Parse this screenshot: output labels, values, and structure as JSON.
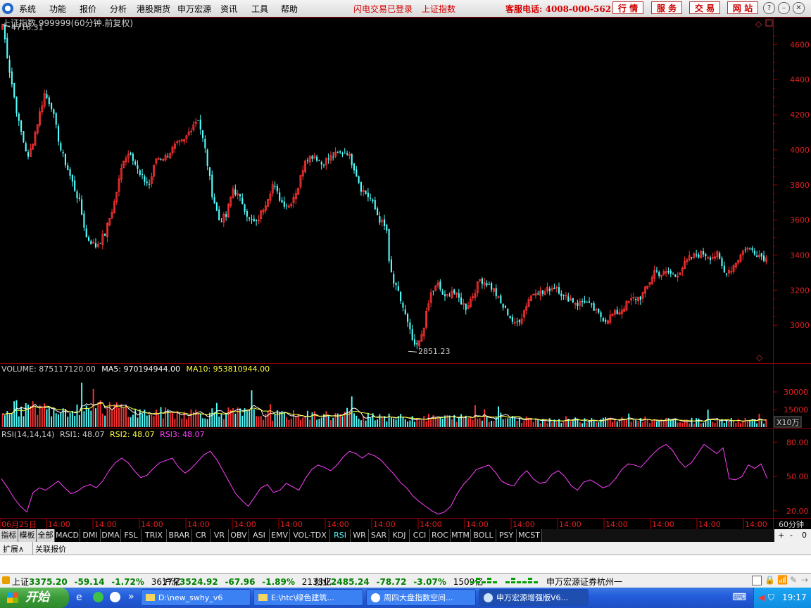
{
  "menu": {
    "items": [
      "系统",
      "功能",
      "报价",
      "分析",
      "港股期货",
      "申万宏源",
      "资讯",
      "工具",
      "帮助"
    ],
    "status1": "闪电交易已登录",
    "status2": "上证指数",
    "hotline": "客服电话: 4008-000-562",
    "nav_buttons": [
      "行 情",
      "服 务",
      "交 易",
      "网 站"
    ]
  },
  "chart_data": [
    {
      "type": "candlestick",
      "title": "上证指数 999999(60分钟.前复权)",
      "ylim": [
        2800,
        4750
      ],
      "yticks": [
        3000,
        3200,
        3400,
        3600,
        3800,
        4000,
        4200,
        4400,
        4600
      ],
      "annotations": [
        {
          "text": "4716.31",
          "value": 4716.31
        },
        {
          "text": "2851.23",
          "value": 2851.23
        }
      ],
      "colors": {
        "up": "#ff3232",
        "down": "#54ffff"
      },
      "close_path": [
        [
          0,
          4716
        ],
        [
          3,
          4450
        ],
        [
          7,
          4150
        ],
        [
          11,
          3950
        ],
        [
          14,
          4100
        ],
        [
          18,
          4320
        ],
        [
          21,
          4250
        ],
        [
          25,
          4000
        ],
        [
          29,
          3850
        ],
        [
          33,
          3700
        ],
        [
          36,
          3500
        ],
        [
          40,
          3450
        ],
        [
          44,
          3520
        ],
        [
          48,
          3700
        ],
        [
          52,
          3950
        ],
        [
          55,
          3990
        ],
        [
          59,
          3850
        ],
        [
          63,
          3800
        ],
        [
          66,
          3950
        ],
        [
          70,
          3960
        ],
        [
          74,
          4020
        ],
        [
          78,
          4050
        ],
        [
          82,
          4150
        ],
        [
          84,
          4180
        ],
        [
          87,
          4000
        ],
        [
          90,
          3750
        ],
        [
          93,
          3600
        ],
        [
          96,
          3620
        ],
        [
          99,
          3780
        ],
        [
          103,
          3700
        ],
        [
          106,
          3600
        ],
        [
          109,
          3580
        ],
        [
          113,
          3700
        ],
        [
          116,
          3800
        ],
        [
          120,
          3700
        ],
        [
          123,
          3680
        ],
        [
          127,
          3790
        ],
        [
          130,
          3950
        ],
        [
          134,
          3970
        ],
        [
          137,
          3920
        ],
        [
          141,
          3960
        ],
        [
          145,
          3980
        ],
        [
          148,
          3990
        ],
        [
          151,
          3900
        ],
        [
          154,
          3780
        ],
        [
          158,
          3720
        ],
        [
          162,
          3600
        ],
        [
          165,
          3540
        ],
        [
          166,
          3350
        ],
        [
          168,
          3240
        ],
        [
          170,
          3180
        ],
        [
          172,
          3100
        ],
        [
          175,
          2960
        ],
        [
          177,
          2870
        ],
        [
          179,
          2900
        ],
        [
          181,
          3000
        ],
        [
          184,
          3180
        ],
        [
          187,
          3230
        ],
        [
          190,
          3150
        ],
        [
          193,
          3200
        ],
        [
          196,
          3150
        ],
        [
          199,
          3100
        ],
        [
          202,
          3170
        ],
        [
          205,
          3260
        ],
        [
          208,
          3240
        ],
        [
          211,
          3200
        ],
        [
          214,
          3120
        ],
        [
          217,
          3070
        ],
        [
          220,
          3000
        ],
        [
          223,
          3050
        ],
        [
          226,
          3150
        ],
        [
          229,
          3200
        ],
        [
          232,
          3180
        ],
        [
          235,
          3210
        ],
        [
          238,
          3220
        ],
        [
          241,
          3160
        ],
        [
          244,
          3150
        ],
        [
          247,
          3120
        ],
        [
          250,
          3140
        ],
        [
          253,
          3100
        ],
        [
          256,
          3060
        ],
        [
          259,
          3030
        ],
        [
          262,
          3060
        ],
        [
          265,
          3080
        ],
        [
          268,
          3120
        ],
        [
          271,
          3150
        ],
        [
          274,
          3160
        ],
        [
          277,
          3220
        ],
        [
          280,
          3310
        ],
        [
          283,
          3290
        ],
        [
          286,
          3300
        ],
        [
          289,
          3280
        ],
        [
          292,
          3330
        ],
        [
          295,
          3380
        ],
        [
          298,
          3400
        ],
        [
          301,
          3410
        ],
        [
          304,
          3390
        ],
        [
          307,
          3400
        ],
        [
          310,
          3300
        ],
        [
          313,
          3320
        ],
        [
          316,
          3380
        ],
        [
          319,
          3440
        ],
        [
          322,
          3430
        ],
        [
          325,
          3400
        ],
        [
          328,
          3380
        ]
      ]
    },
    {
      "type": "bar",
      "title": "VOLUME",
      "label_volume": "VOLUME: 875117120.00",
      "label_ma5": "MA5: 970194944.00",
      "label_ma10": "MA10: 953810944.00",
      "ylim": [
        0,
        45000
      ],
      "yticks": [
        15000,
        30000
      ],
      "unit": "X10万",
      "levels": [
        16000,
        12000,
        10000,
        8000,
        6000,
        5500
      ],
      "colors": {
        "ma5": "#ffffff",
        "ma10": "#ffff40"
      }
    },
    {
      "type": "line",
      "title": "RSI",
      "label_rsi": "RSI(14,14,14)",
      "label_rsi1": "RSI1: 48.07",
      "label_rsi2": "RSI2: 48.07",
      "label_rsi3": "RSI3: 48.07",
      "ylim": [
        15,
        90
      ],
      "yticks": [
        20.0,
        50.0,
        80.0
      ],
      "ytick_labels": [
        "20.00",
        "50.00",
        "80.00"
      ],
      "values": [
        48,
        40,
        31,
        24,
        19,
        36,
        40,
        38,
        42,
        46,
        40,
        35,
        37,
        41,
        43,
        40,
        46,
        55,
        62,
        66,
        62,
        55,
        49,
        51,
        57,
        62,
        64,
        66,
        58,
        53,
        57,
        63,
        69,
        72,
        65,
        55,
        45,
        35,
        29,
        24,
        32,
        40,
        43,
        36,
        38,
        44,
        41,
        38,
        48,
        56,
        60,
        58,
        55,
        60,
        67,
        72,
        70,
        66,
        70,
        68,
        64,
        58,
        52,
        45,
        40,
        33,
        28,
        24,
        20,
        17,
        19,
        24,
        35,
        43,
        49,
        56,
        58,
        60,
        54,
        46,
        43,
        42,
        50,
        55,
        48,
        44,
        45,
        52,
        55,
        50,
        42,
        38,
        45,
        47,
        44,
        40,
        42,
        48,
        56,
        61,
        60,
        58,
        64,
        70,
        75,
        78,
        73,
        64,
        58,
        62,
        70,
        78,
        74,
        70,
        75,
        48,
        47,
        50,
        60,
        57,
        61,
        48
      ]
    }
  ],
  "xaxis": {
    "date": "06月25日",
    "tick": "14:00",
    "period": "60分钟"
  },
  "indicator_tabs": [
    "指标",
    "模板",
    "全部",
    "MACD",
    "DMI",
    "DMA",
    "FSL",
    "TRIX",
    "BRAR",
    "CR",
    "VR",
    "OBV",
    "ASI",
    "EMV",
    "VOL-TDX",
    "RSI",
    "WR",
    "SAR",
    "KDJ",
    "CCI",
    "ROC",
    "MTM",
    "BOLL",
    "PSY",
    "MCST"
  ],
  "active_tab": "RSI",
  "right_tools": [
    "+",
    "-",
    "0"
  ],
  "sub_tabs": [
    "扩展∧",
    "关联报价"
  ],
  "quotes": {
    "sh_label": "上证",
    "sh_price": "3375.20",
    "sh_chg": "-59.14",
    "sh_pct": "-1.72%",
    "sh_amt": "3617亿",
    "hs_label": "沪深",
    "hs_price": "3524.92",
    "hs_chg": "-67.96",
    "hs_pct": "-1.89%",
    "hs_amt": "2133亿",
    "cy_label": "创业",
    "cy_price": "2485.24",
    "cy_chg": "-78.72",
    "cy_pct": "-3.07%",
    "cy_amt": "1509亿",
    "broker": "申万宏源证券杭州一"
  },
  "taskbar": {
    "start": "开始",
    "tasks": [
      "D:\\new_swhy_v6",
      "E:\\htc\\绿色建筑...",
      "周四大盘指数空间...",
      "申万宏源增强版V6..."
    ],
    "clock": "19:17"
  }
}
